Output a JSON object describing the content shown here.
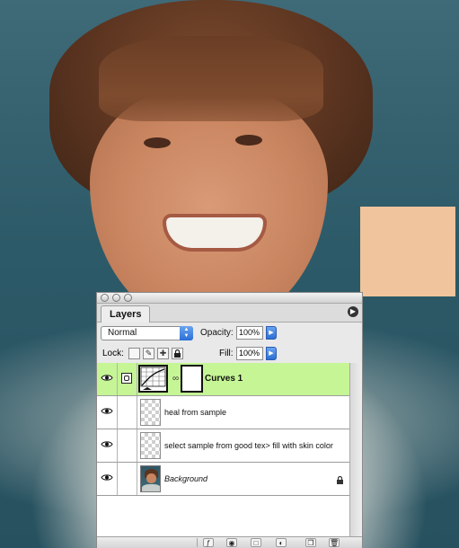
{
  "panel": {
    "tab_label": "Layers",
    "blend_mode": "Normal",
    "opacity_label": "Opacity:",
    "opacity_value": "100%",
    "lock_label": "Lock:",
    "fill_label": "Fill:",
    "fill_value": "100%"
  },
  "layers": [
    {
      "name": "Curves 1",
      "type": "adjustment",
      "selected": true
    },
    {
      "name": "heal from sample",
      "type": "pixel",
      "selected": false
    },
    {
      "name": "select sample from good tex> fill with skin color",
      "type": "pixel",
      "selected": false
    },
    {
      "name": "Background",
      "type": "background",
      "locked": true,
      "selected": false
    }
  ],
  "colors": {
    "selected_row": "#c5f595",
    "sample_swatch": "#f0c49c",
    "canvas_background": "#2f5d6b"
  },
  "icons": [
    "eye-icon",
    "adjustment-layer-icon",
    "chain-link-icon",
    "lock-icon",
    "panel-menu-icon",
    "blend-arrows-icon",
    "opacity-arrow-icon",
    "lock-transparent-icon",
    "lock-image-icon",
    "lock-position-icon",
    "lock-all-icon",
    "layer-style-icon",
    "layer-mask-icon",
    "new-group-icon",
    "new-adjustment-layer-icon",
    "new-layer-icon",
    "trash-icon"
  ]
}
